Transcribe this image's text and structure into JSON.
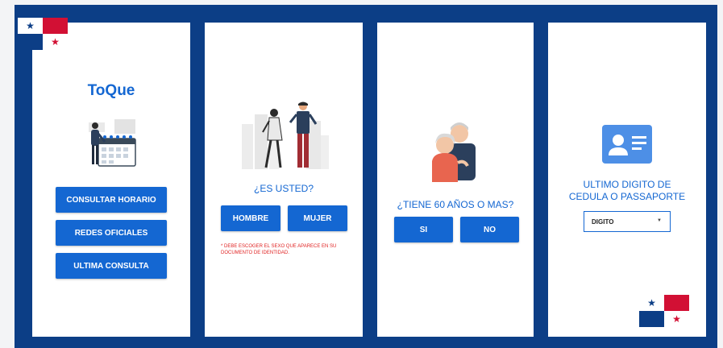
{
  "app": {
    "name": "ToQue"
  },
  "screen1": {
    "buttons": [
      "CONSULTAR HORARIO",
      "REDES OFICIALES",
      "ULTIMA CONSULTA"
    ]
  },
  "screen2": {
    "question": "¿ES USTED?",
    "buttons": [
      "HOMBRE",
      "MUJER"
    ],
    "note": "* DEBE ESCOGER EL SEXO QUE APARECE EN SU DOCUMENTO DE IDENTIDAD."
  },
  "screen3": {
    "question": "¿TIENE 60 AÑOS O MAS?",
    "buttons": [
      "SI",
      "NO"
    ]
  },
  "screen4": {
    "question_line1": "ULTIMO DIGITO DE",
    "question_line2": "CEDULA O PASSAPORTE",
    "select_value": "DIGITO"
  },
  "colors": {
    "brand_blue": "#1467d2",
    "frame_navy": "#0c3e86",
    "flag_red": "#d21034",
    "note_red": "#e02323"
  },
  "icons": [
    "panama-flag-icon",
    "calendar-person-illustration",
    "man-woman-illustration",
    "elderly-couple-illustration",
    "id-card-icon",
    "dropdown-caret-icon"
  ]
}
